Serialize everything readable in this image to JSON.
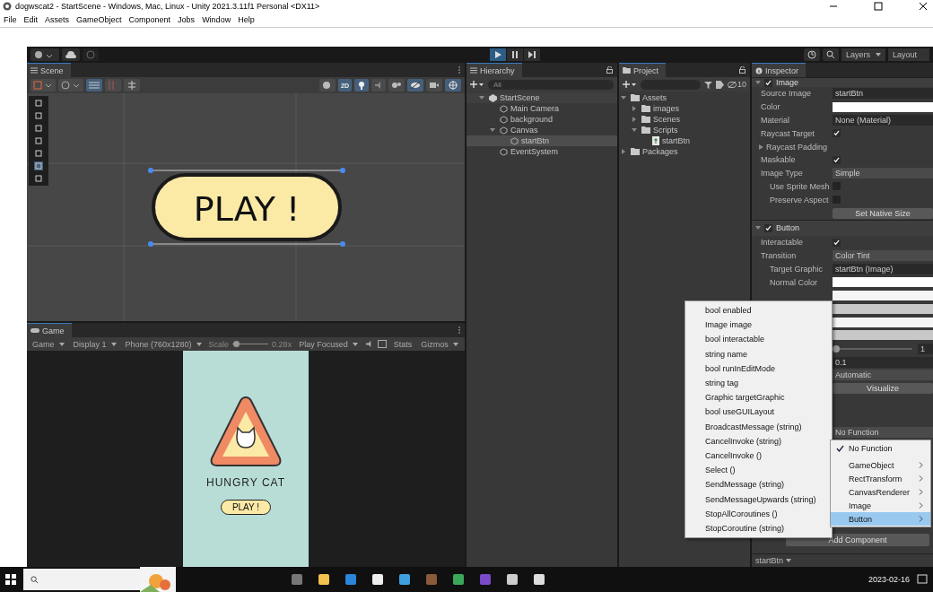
{
  "window": {
    "title": "dogwscat2 - StartScene - Windows, Mac, Linux - Unity 2021.3.11f1 Personal <DX11>"
  },
  "menu": [
    "File",
    "Edit",
    "Assets",
    "GameObject",
    "Component",
    "Jobs",
    "Window",
    "Help"
  ],
  "toolbar": {
    "play_on": true,
    "layers": "Layers",
    "layout": "Layout"
  },
  "scene": {
    "tab": "Scene",
    "mode_2d": {
      "label": "2D",
      "on": true
    },
    "graphic_label": "PLAY !"
  },
  "game": {
    "tab": "Game",
    "controls": [
      {
        "kind": "dropdown",
        "label": "Game"
      },
      {
        "kind": "dropdown",
        "label": "Display 1"
      },
      {
        "kind": "dropdown",
        "label": "Phone (760x1280)"
      },
      {
        "kind": "slider",
        "label": "Scale",
        "level": 0.05,
        "reading": "0.28x"
      },
      {
        "kind": "dropdown",
        "label": "Play Focused"
      },
      {
        "kind": "icons"
      },
      {
        "kind": "button",
        "label": "Stats"
      },
      {
        "kind": "dropdown",
        "label": "Gizmos"
      }
    ],
    "title": "HUNGRY CAT",
    "button": "PLAY !"
  },
  "hierarchy": {
    "tab": "Hierarchy",
    "search_placeholder": "All",
    "tree": [
      {
        "name": "StartScene",
        "kind": "scene",
        "expanded": true,
        "selected": false,
        "children": [
          {
            "name": "Main Camera",
            "kind": "object",
            "selected": false
          },
          {
            "name": "background",
            "kind": "object",
            "selected": false
          },
          {
            "name": "Canvas",
            "kind": "object",
            "expanded": true,
            "selected": false,
            "children": [
              {
                "name": "startBtn",
                "kind": "object",
                "selected": true
              }
            ]
          },
          {
            "name": "EventSystem",
            "kind": "object",
            "selected": false
          }
        ]
      }
    ]
  },
  "project": {
    "tab": "Project",
    "hidden_count": "10",
    "tree": [
      {
        "name": "Assets",
        "kind": "folder",
        "expanded": true,
        "selected": false,
        "children": [
          {
            "name": "images",
            "kind": "folder",
            "expanded": false,
            "selected": false
          },
          {
            "name": "Scenes",
            "kind": "folder",
            "expanded": false,
            "selected": false
          },
          {
            "name": "Scripts",
            "kind": "folder",
            "expanded": true,
            "selected": false,
            "children": [
              {
                "name": "startBtn",
                "kind": "script",
                "selected": false
              }
            ]
          }
        ]
      },
      {
        "name": "Packages",
        "kind": "folder",
        "expanded": false,
        "selected": false
      }
    ]
  },
  "inspector": {
    "tab": "Inspector",
    "components": [
      {
        "title": "Image",
        "enabled": true,
        "rows": [
          {
            "kind": "object",
            "label": "Source Image",
            "value": "startBtn",
            "indent": false
          },
          {
            "kind": "color",
            "label": "Color",
            "color": "#ffffff",
            "indent": false
          },
          {
            "kind": "object",
            "label": "Material",
            "value": "None (Material)",
            "indent": false
          },
          {
            "kind": "check",
            "label": "Raycast Target",
            "checked": true,
            "indent": false
          },
          {
            "kind": "foldout",
            "label": "Raycast Padding",
            "indent": false
          },
          {
            "kind": "check",
            "label": "Maskable",
            "checked": true,
            "indent": false
          },
          {
            "kind": "dropdown",
            "label": "Image Type",
            "value": "Simple",
            "indent": false
          },
          {
            "kind": "check",
            "label": "Use Sprite Mesh",
            "checked": false,
            "indent": true
          },
          {
            "kind": "check",
            "label": "Preserve Aspect",
            "checked": false,
            "indent": true
          },
          {
            "kind": "button",
            "value": "Set Native Size"
          }
        ]
      },
      {
        "title": "Button",
        "enabled": true,
        "rows": [
          {
            "kind": "check",
            "label": "Interactable",
            "checked": true,
            "indent": false
          },
          {
            "kind": "dropdown",
            "label": "Transition",
            "value": "Color Tint",
            "indent": false
          },
          {
            "kind": "object",
            "label": "Target Graphic",
            "value": "startBtn (Image)",
            "indent": true
          },
          {
            "kind": "color",
            "label": "Normal Color",
            "color": "#ffffff",
            "indent": true
          },
          {
            "kind": "color",
            "color": "#f5f5f5"
          },
          {
            "kind": "color",
            "color": "#c8c8c8"
          },
          {
            "kind": "color",
            "color": "#f5f5f5"
          },
          {
            "kind": "color",
            "color": "#c8c8c8"
          },
          {
            "kind": "slider",
            "level": 0,
            "reading": "1"
          },
          {
            "kind": "text",
            "value": "0.1"
          },
          {
            "kind": "dropdown",
            "value": "Automatic"
          },
          {
            "kind": "button",
            "value": "Visualize"
          }
        ]
      }
    ],
    "event_function": "No Function",
    "add_component": "Add Component",
    "footer": "startBtn"
  },
  "method_menu": [
    "bool enabled",
    "Image image",
    "bool interactable",
    "string name",
    "bool runInEditMode",
    "string tag",
    "Graphic targetGraphic",
    "bool useGUILayout",
    "BroadcastMessage (string)",
    "CancelInvoke (string)",
    "CancelInvoke ()",
    "Select ()",
    "SendMessage (string)",
    "SendMessageUpwards (string)",
    "StopAllCoroutines ()",
    "StopCoroutine (string)"
  ],
  "function_menu": [
    {
      "label": "No Function",
      "checked": true,
      "selected": false,
      "submenu": false
    },
    {
      "label": "GameObject",
      "checked": false,
      "selected": false,
      "submenu": true
    },
    {
      "label": "RectTransform",
      "checked": false,
      "selected": false,
      "submenu": true
    },
    {
      "label": "CanvasRenderer",
      "checked": false,
      "selected": false,
      "submenu": true
    },
    {
      "label": "Image",
      "checked": false,
      "selected": false,
      "submenu": true
    },
    {
      "label": "Button",
      "checked": false,
      "selected": true,
      "submenu": true
    }
  ],
  "taskbar": {
    "date": "2023-02-16"
  }
}
